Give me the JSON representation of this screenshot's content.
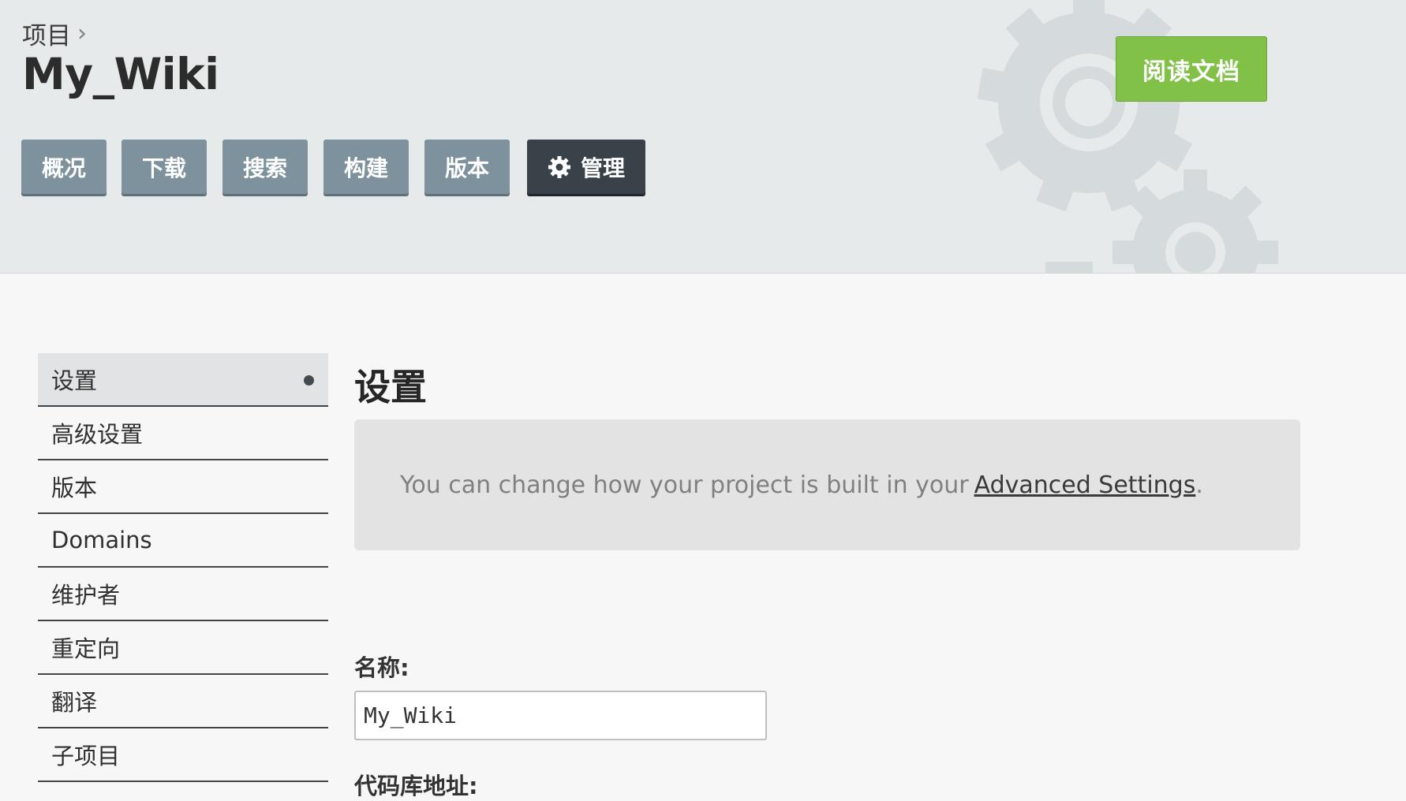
{
  "header": {
    "breadcrumb": "项目",
    "project_title": "My_Wiki",
    "read_docs_label": "阅读文档"
  },
  "tabs": [
    {
      "label": "概况",
      "active": false
    },
    {
      "label": "下载",
      "active": false
    },
    {
      "label": "搜索",
      "active": false
    },
    {
      "label": "构建",
      "active": false
    },
    {
      "label": "版本",
      "active": false
    },
    {
      "label": "管理",
      "active": true,
      "icon": "gear-icon"
    }
  ],
  "sidebar": {
    "items": [
      {
        "label": "设置",
        "active": true
      },
      {
        "label": "高级设置",
        "active": false
      },
      {
        "label": "版本",
        "active": false
      },
      {
        "label": "Domains",
        "active": false
      },
      {
        "label": "维护者",
        "active": false
      },
      {
        "label": "重定向",
        "active": false
      },
      {
        "label": "翻译",
        "active": false
      },
      {
        "label": "子项目",
        "active": false
      }
    ]
  },
  "main": {
    "heading": "设置",
    "notice_text": "You can change how your project is built in your",
    "notice_link": "Advanced Settings",
    "notice_period": ".",
    "fields": {
      "name_label": "名称:",
      "name_value": "My_Wiki",
      "repo_label": "代码库地址:"
    }
  },
  "colors": {
    "read_docs_button": "#82c147",
    "tab": "#7d929c",
    "tab_active": "#384248",
    "header_bg": "#e7eaeb"
  }
}
